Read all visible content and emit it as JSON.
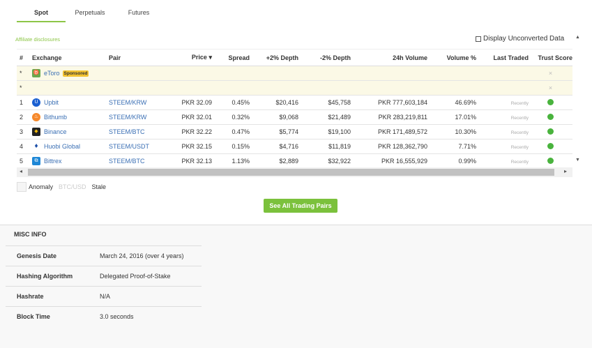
{
  "tabs": [
    "Spot",
    "Perpetuals",
    "Futures"
  ],
  "affiliate_label": "Affiliate disclosures",
  "unconverted_label": "Display Unconverted Data",
  "columns": {
    "num": "#",
    "exchange": "Exchange",
    "pair": "Pair",
    "price": "Price",
    "spread": "Spread",
    "depth_plus": "+2% Depth",
    "depth_minus": "-2% Depth",
    "volume": "24h Volume",
    "volume_pct": "Volume %",
    "last_traded": "Last Traded",
    "trust": "Trust Score"
  },
  "sponsored": {
    "num": "*",
    "exchange": "eToro",
    "badge": "Sponsored"
  },
  "blank_row": {
    "num": "*"
  },
  "rows": [
    {
      "num": "1",
      "exchange": "Upbit",
      "pair": "STEEM/KRW",
      "price": "PKR 32.09",
      "spread": "0.45%",
      "depth_plus": "$20,416",
      "depth_minus": "$45,758",
      "volume": "PKR 777,603,184",
      "volume_pct": "46.69%",
      "last_traded": "Recently"
    },
    {
      "num": "2",
      "exchange": "Bithumb",
      "pair": "STEEM/KRW",
      "price": "PKR 32.01",
      "spread": "0.32%",
      "depth_plus": "$9,068",
      "depth_minus": "$21,489",
      "volume": "PKR 283,219,811",
      "volume_pct": "17.01%",
      "last_traded": "Recently"
    },
    {
      "num": "3",
      "exchange": "Binance",
      "pair": "STEEM/BTC",
      "price": "PKR 32.22",
      "spread": "0.47%",
      "depth_plus": "$5,774",
      "depth_minus": "$19,100",
      "volume": "PKR 171,489,572",
      "volume_pct": "10.30%",
      "last_traded": "Recently"
    },
    {
      "num": "4",
      "exchange": "Huobi Global",
      "pair": "STEEM/USDT",
      "price": "PKR 32.15",
      "spread": "0.15%",
      "depth_plus": "$4,716",
      "depth_minus": "$11,819",
      "volume": "PKR 128,362,790",
      "volume_pct": "7.71%",
      "last_traded": "Recently"
    },
    {
      "num": "5",
      "exchange": "Bittrex",
      "pair": "STEEM/BTC",
      "price": "PKR 32.13",
      "spread": "1.13%",
      "depth_plus": "$2,889",
      "depth_minus": "$32,922",
      "volume": "PKR 16,555,929",
      "volume_pct": "0.99%",
      "last_traded": "Recently"
    }
  ],
  "legend": {
    "anomaly": "Anomaly",
    "btcusd": "BTC/USD",
    "stale": "Stale"
  },
  "see_all_label": "See All Trading Pairs",
  "misc": {
    "title": "MISC INFO",
    "rows": [
      {
        "key": "Genesis Date",
        "value": "March 24, 2016 (over 4 years)"
      },
      {
        "key": "Hashing Algorithm",
        "value": "Delegated Proof-of-Stake"
      },
      {
        "key": "Hashrate",
        "value": "N/A"
      },
      {
        "key": "Block Time",
        "value": "3.0 seconds"
      }
    ]
  },
  "colors": {
    "accent": "#8dc647",
    "link": "#3a6fb4",
    "trust_green": "#49b33d",
    "badge": "#f2c230"
  }
}
